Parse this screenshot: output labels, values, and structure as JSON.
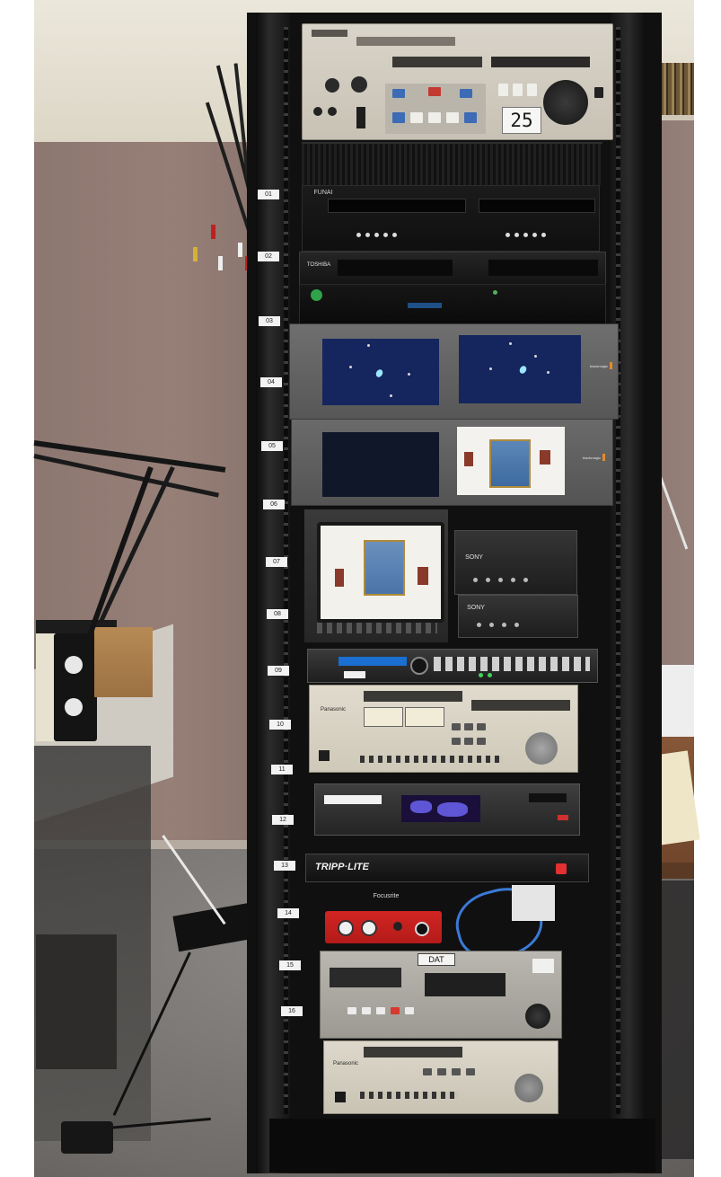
{
  "scene": {
    "rack_unit_labels": [
      "01",
      "02",
      "03",
      "04",
      "05",
      "06",
      "07",
      "08",
      "09",
      "10",
      "11",
      "12",
      "13",
      "14",
      "15",
      "16"
    ],
    "device_text": {
      "top_deck_counter": "25",
      "funai_brand": "FUNAI",
      "toshiba_brand": "TOSHIBA",
      "blackmagic_brand": "blackmagic",
      "sony_brand": "SONY",
      "panasonic_brand": "Panasonic",
      "tripp_lite_brand": "TRIPP·LITE",
      "focusrite_brand": "Focusrite",
      "dat_label": "DAT"
    },
    "colors": {
      "wall": "#8f7a74",
      "rack": "#131313",
      "ceiling": "#e9e5d9",
      "focusrite_red": "#c8201f",
      "screen_blue": "#15255e"
    }
  }
}
